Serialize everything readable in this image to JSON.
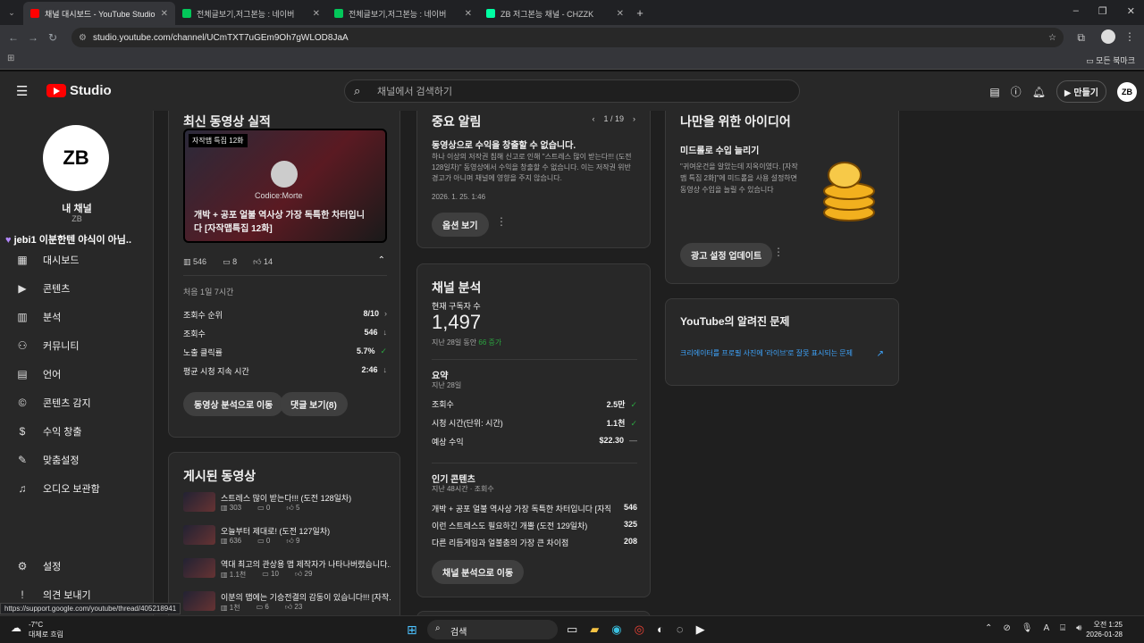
{
  "browser": {
    "tabs": [
      {
        "title": "채널 대시보드 - YouTube Studio",
        "color": "#ff0000",
        "active": true
      },
      {
        "title": "전체글보기,저그본능 : 네이버",
        "color": "#03c75a",
        "active": false
      },
      {
        "title": "전체글보기,저그본능 : 네이버",
        "color": "#03c75a",
        "active": false
      },
      {
        "title": "ZB 저그본능 채널 - CHZZK",
        "color": "#00ffa3",
        "active": false
      }
    ],
    "url": "studio.youtube.com/channel/UCmTXT7uGEm9Oh7gWLOD8JaA",
    "bookmarks_label": "모든 북마크"
  },
  "header": {
    "logo_text": "Studio",
    "search_placeholder": "채널에서 검색하기",
    "create_label": "만들기",
    "avatar_text": "ZB"
  },
  "sidebar": {
    "avatar_text": "ZB",
    "channel_name": "내 채널",
    "channel_sub": "ZB",
    "chat_overlay": "jebi1 이분한텐 야식이 아님..",
    "items": [
      {
        "label": "대시보드",
        "icon": "dashboard-icon",
        "glyph": "▦"
      },
      {
        "label": "콘텐츠",
        "icon": "content-icon",
        "glyph": "▶"
      },
      {
        "label": "분석",
        "icon": "analytics-icon",
        "glyph": "▥"
      },
      {
        "label": "커뮤니티",
        "icon": "community-icon",
        "glyph": "⚇"
      },
      {
        "label": "언어",
        "icon": "subtitles-icon",
        "glyph": "▤"
      },
      {
        "label": "콘텐츠 감지",
        "icon": "copyright-icon",
        "glyph": "©"
      },
      {
        "label": "수익 창출",
        "icon": "monetization-icon",
        "glyph": "$"
      },
      {
        "label": "맞춤설정",
        "icon": "customization-icon",
        "glyph": "✎"
      },
      {
        "label": "오디오 보관함",
        "icon": "audio-library-icon",
        "glyph": "♫"
      }
    ],
    "settings_label": "설정",
    "feedback_label": "의견 보내기"
  },
  "latest_video": {
    "title": "최신 동영상 실적",
    "thumb_badge": "자작맵 특집 12화",
    "thumb_brand": "Codice:Morte",
    "video_title": "개박 + 공포 얼불 역사상 가장 독특한 차터입니다 [자작맵특집 12화]",
    "views": "546",
    "comments": "8",
    "likes": "14",
    "period": "처음 1일 7시간",
    "stats": [
      {
        "label": "조회수 순위",
        "value": "8/10",
        "mark": "›"
      },
      {
        "label": "조회수",
        "value": "546",
        "mark": "↓"
      },
      {
        "label": "노출 클릭률",
        "value": "5.7%",
        "mark": "✓"
      },
      {
        "label": "평균 시청 지속 시간",
        "value": "2:46",
        "mark": "↓"
      }
    ],
    "btn_analytics": "동영상 분석으로 이동",
    "btn_comments": "댓글 보기(8)"
  },
  "published": {
    "title": "게시된 동영상",
    "videos": [
      {
        "title": "스트레스 많이 받는다!!! (도전 128일차)",
        "views": "303",
        "comments": "0",
        "likes": "5"
      },
      {
        "title": "오늘부터 제대로! (도전 127일차)",
        "views": "636",
        "comments": "0",
        "likes": "9"
      },
      {
        "title": "역대 최고의 관상용 맵 제작자가 나타나버렸습니다...",
        "views": "1.1천",
        "comments": "10",
        "likes": "29"
      },
      {
        "title": "이분의 맵에는 기승전결의 감동이 있습니다!!! [자작...",
        "views": "1천",
        "comments": "6",
        "likes": "23"
      }
    ]
  },
  "alerts": {
    "title": "중요 알림",
    "pager": "1 / 19",
    "heading": "동영상으로 수익을 창출할 수 없습니다.",
    "body": "하나 이상의 저작권 침해 신고로 인해 \"스트레스 많이 받는다!!! (도전 128일차)\" 동영상에서 수익을 창출할 수 없습니다. 이는 저작권 위반 경고가 아니며 채널에 영향을 주지 않습니다.",
    "date": "2026. 1. 25. 1:46",
    "button": "옵션 보기"
  },
  "analytics": {
    "title": "채널 분석",
    "subs_label": "현재 구독자 수",
    "subs_value": "1,497",
    "subs_delta_prefix": "지난 28일 동안",
    "subs_delta": "66 증가",
    "summary_title": "요약",
    "summary_period": "지난 28일",
    "summary": [
      {
        "label": "조회수",
        "value": "2.5만",
        "mark": "✓"
      },
      {
        "label": "시청 시간(단위: 시간)",
        "value": "1.1천",
        "mark": "✓"
      },
      {
        "label": "예상 수익",
        "value": "$22.30",
        "mark": "—"
      }
    ],
    "top_title": "인기 콘텐츠",
    "top_period": "지난 48시간 · 조회수",
    "top": [
      {
        "title": "개박 + 공포 얼불 역사상 가장 독특한 차터입니다 [자작맵...",
        "value": "546"
      },
      {
        "title": "이런 스트레스도 필요하긴 개뿔 (도전 129일차)",
        "value": "325"
      },
      {
        "title": "다른 리듬게임과 얼불춤의 가장 큰 차이점",
        "value": "208"
      }
    ],
    "button": "채널 분석으로 이동"
  },
  "ideas": {
    "title": "나만을 위한 아이디어",
    "heading": "미드롤로 수입 늘리기",
    "body": "\"귀여운건을 알았는데 지옥이였다. [자작맵 특집 2화]\"에 미드롤을 사용 설정하면 동영상 수입을 늘릴 수 있습니다",
    "button": "광고 설정 업데이트"
  },
  "known_issues": {
    "title": "YouTube의 알려진 문제",
    "link": "크리에이터를 프로필 사진에 '라이브'로 잘못 표시되는 문제"
  },
  "status_url": "https://support.google.com/youtube/thread/405218941",
  "taskbar": {
    "weather_temp": "-7°C",
    "weather_desc": "대체로 흐림",
    "search_label": "검색",
    "time": "오전 1:25",
    "date": "2026-01-28"
  }
}
